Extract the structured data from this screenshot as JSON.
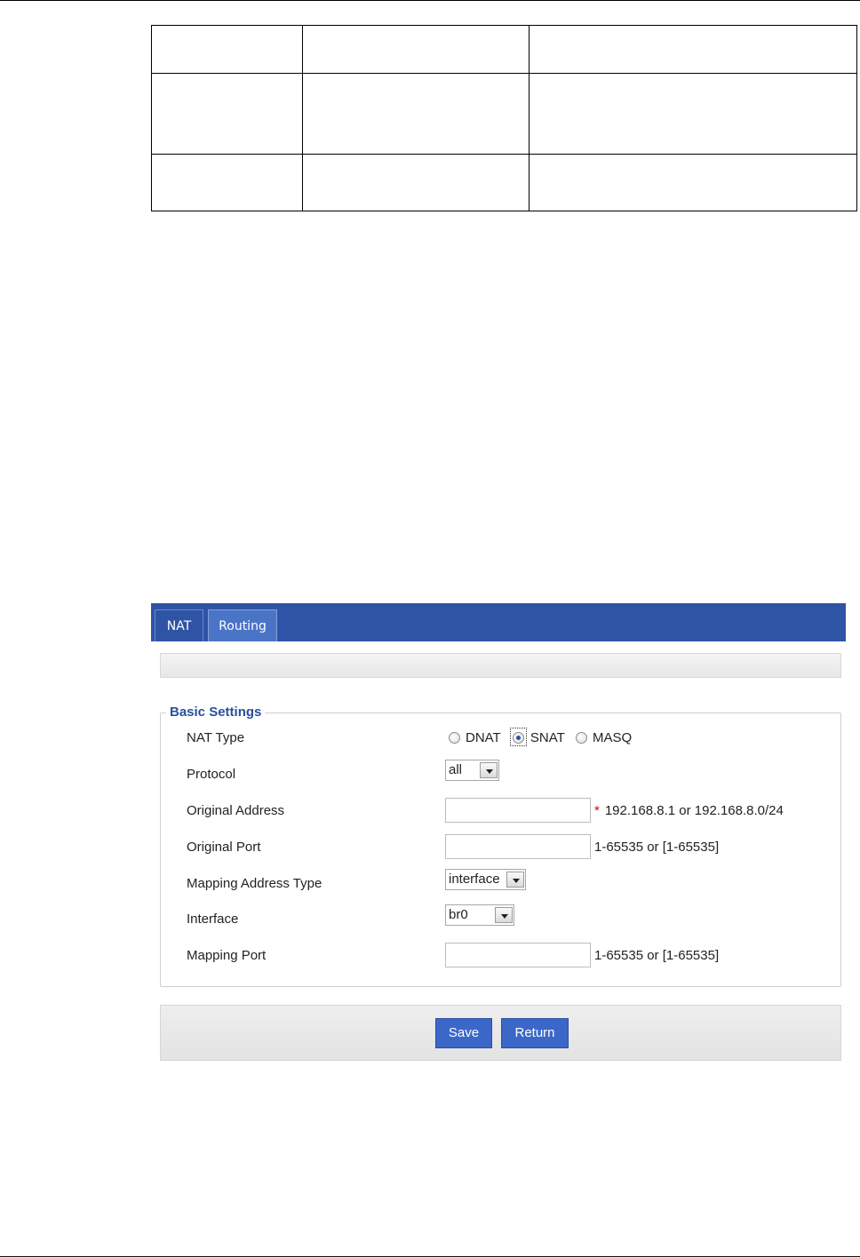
{
  "doc_table": {
    "rows": 3,
    "cols": 3
  },
  "tabs": [
    {
      "label": "NAT"
    },
    {
      "label": "Routing"
    }
  ],
  "basic_settings": {
    "legend": "Basic Settings",
    "nat_type": {
      "label": "NAT Type",
      "options": [
        "DNAT",
        "SNAT",
        "MASQ"
      ],
      "selected": "SNAT"
    },
    "protocol": {
      "label": "Protocol",
      "value": "all"
    },
    "original_address": {
      "label": "Original Address",
      "value": "",
      "required_mark": "*",
      "hint": "192.168.8.1 or 192.168.8.0/24"
    },
    "original_port": {
      "label": "Original Port",
      "value": "",
      "hint": "1-65535 or [1-65535]"
    },
    "mapping_address_type": {
      "label": "Mapping Address Type",
      "value": "interface"
    },
    "interface": {
      "label": "Interface",
      "value": "br0"
    },
    "mapping_port": {
      "label": "Mapping Port",
      "value": "",
      "hint": "1-65535 or [1-65535]"
    }
  },
  "buttons": {
    "save": "Save",
    "return": "Return"
  },
  "colors": {
    "tabbar": "#2f54a6",
    "legend": "#2a4f9b",
    "button": "#3b68c8",
    "required": "#d40000"
  }
}
